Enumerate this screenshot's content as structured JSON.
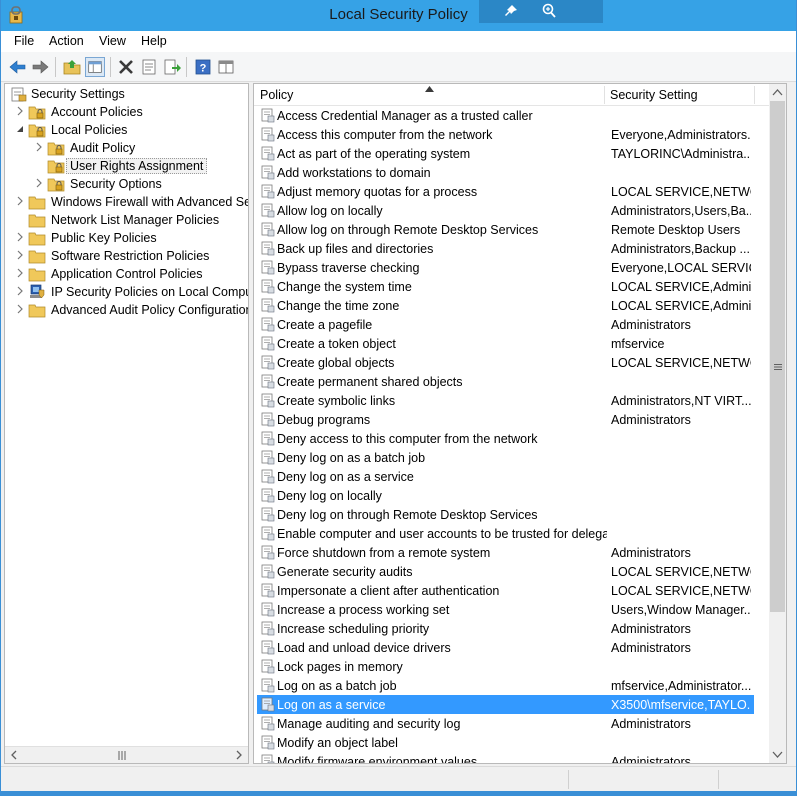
{
  "window": {
    "title": "Local Security Policy",
    "accent_color": "#36a2e6",
    "icons": [
      "app-shield-icon",
      "pin-icon",
      "magnifier-icon"
    ]
  },
  "menu": [
    "File",
    "Action",
    "View",
    "Help"
  ],
  "toolbar": {
    "buttons": [
      "back-icon",
      "forward-icon",
      "up-folder-icon",
      "show-hide-tree-icon",
      "delete-icon",
      "properties-icon",
      "export-list-icon",
      "help-icon",
      "console-view-icon"
    ]
  },
  "tree": {
    "root": "Security Settings",
    "items": [
      "Account Policies",
      "Local Policies",
      "Audit Policy",
      "User Rights Assignment",
      "Security Options",
      "Windows Firewall with Advanced Security",
      "Network List Manager Policies",
      "Public Key Policies",
      "Software Restriction Policies",
      "Application Control Policies",
      "IP Security Policies on Local Computer",
      "Advanced Audit Policy Configuration"
    ],
    "selected": "User Rights Assignment"
  },
  "list": {
    "columns": [
      "Policy",
      "Security Setting"
    ],
    "selected_index": 31,
    "selection_color": "#3399ff",
    "rows": [
      {
        "policy": "Access Credential Manager as a trusted caller",
        "setting": ""
      },
      {
        "policy": "Access this computer from the network",
        "setting": "Everyone,Administrators..."
      },
      {
        "policy": "Act as part of the operating system",
        "setting": "TAYLORINC\\Administra..."
      },
      {
        "policy": "Add workstations to domain",
        "setting": ""
      },
      {
        "policy": "Adjust memory quotas for a process",
        "setting": "LOCAL SERVICE,NETWO..."
      },
      {
        "policy": "Allow log on locally",
        "setting": "Administrators,Users,Ba..."
      },
      {
        "policy": "Allow log on through Remote Desktop Services",
        "setting": "Remote Desktop Users"
      },
      {
        "policy": "Back up files and directories",
        "setting": "Administrators,Backup ..."
      },
      {
        "policy": "Bypass traverse checking",
        "setting": "Everyone,LOCAL SERVIC..."
      },
      {
        "policy": "Change the system time",
        "setting": "LOCAL SERVICE,Admini..."
      },
      {
        "policy": "Change the time zone",
        "setting": "LOCAL SERVICE,Admini..."
      },
      {
        "policy": "Create a pagefile",
        "setting": "Administrators"
      },
      {
        "policy": "Create a token object",
        "setting": "mfservice"
      },
      {
        "policy": "Create global objects",
        "setting": "LOCAL SERVICE,NETWO..."
      },
      {
        "policy": "Create permanent shared objects",
        "setting": ""
      },
      {
        "policy": "Create symbolic links",
        "setting": "Administrators,NT VIRT..."
      },
      {
        "policy": "Debug programs",
        "setting": "Administrators"
      },
      {
        "policy": "Deny access to this computer from the network",
        "setting": ""
      },
      {
        "policy": "Deny log on as a batch job",
        "setting": ""
      },
      {
        "policy": "Deny log on as a service",
        "setting": ""
      },
      {
        "policy": "Deny log on locally",
        "setting": ""
      },
      {
        "policy": "Deny log on through Remote Desktop Services",
        "setting": ""
      },
      {
        "policy": "Enable computer and user accounts to be trusted for delega...",
        "setting": ""
      },
      {
        "policy": "Force shutdown from a remote system",
        "setting": "Administrators"
      },
      {
        "policy": "Generate security audits",
        "setting": "LOCAL SERVICE,NETWO..."
      },
      {
        "policy": "Impersonate a client after authentication",
        "setting": "LOCAL SERVICE,NETWO..."
      },
      {
        "policy": "Increase a process working set",
        "setting": "Users,Window Manager..."
      },
      {
        "policy": "Increase scheduling priority",
        "setting": "Administrators"
      },
      {
        "policy": "Load and unload device drivers",
        "setting": "Administrators"
      },
      {
        "policy": "Lock pages in memory",
        "setting": ""
      },
      {
        "policy": "Log on as a batch job",
        "setting": "mfservice,Administrator..."
      },
      {
        "policy": "Log on as a service",
        "setting": "X3500\\mfservice,TAYLO..."
      },
      {
        "policy": "Manage auditing and security log",
        "setting": "Administrators"
      },
      {
        "policy": "Modify an object label",
        "setting": ""
      },
      {
        "policy": "Modify firmware environment values",
        "setting": "Administrators"
      }
    ]
  }
}
